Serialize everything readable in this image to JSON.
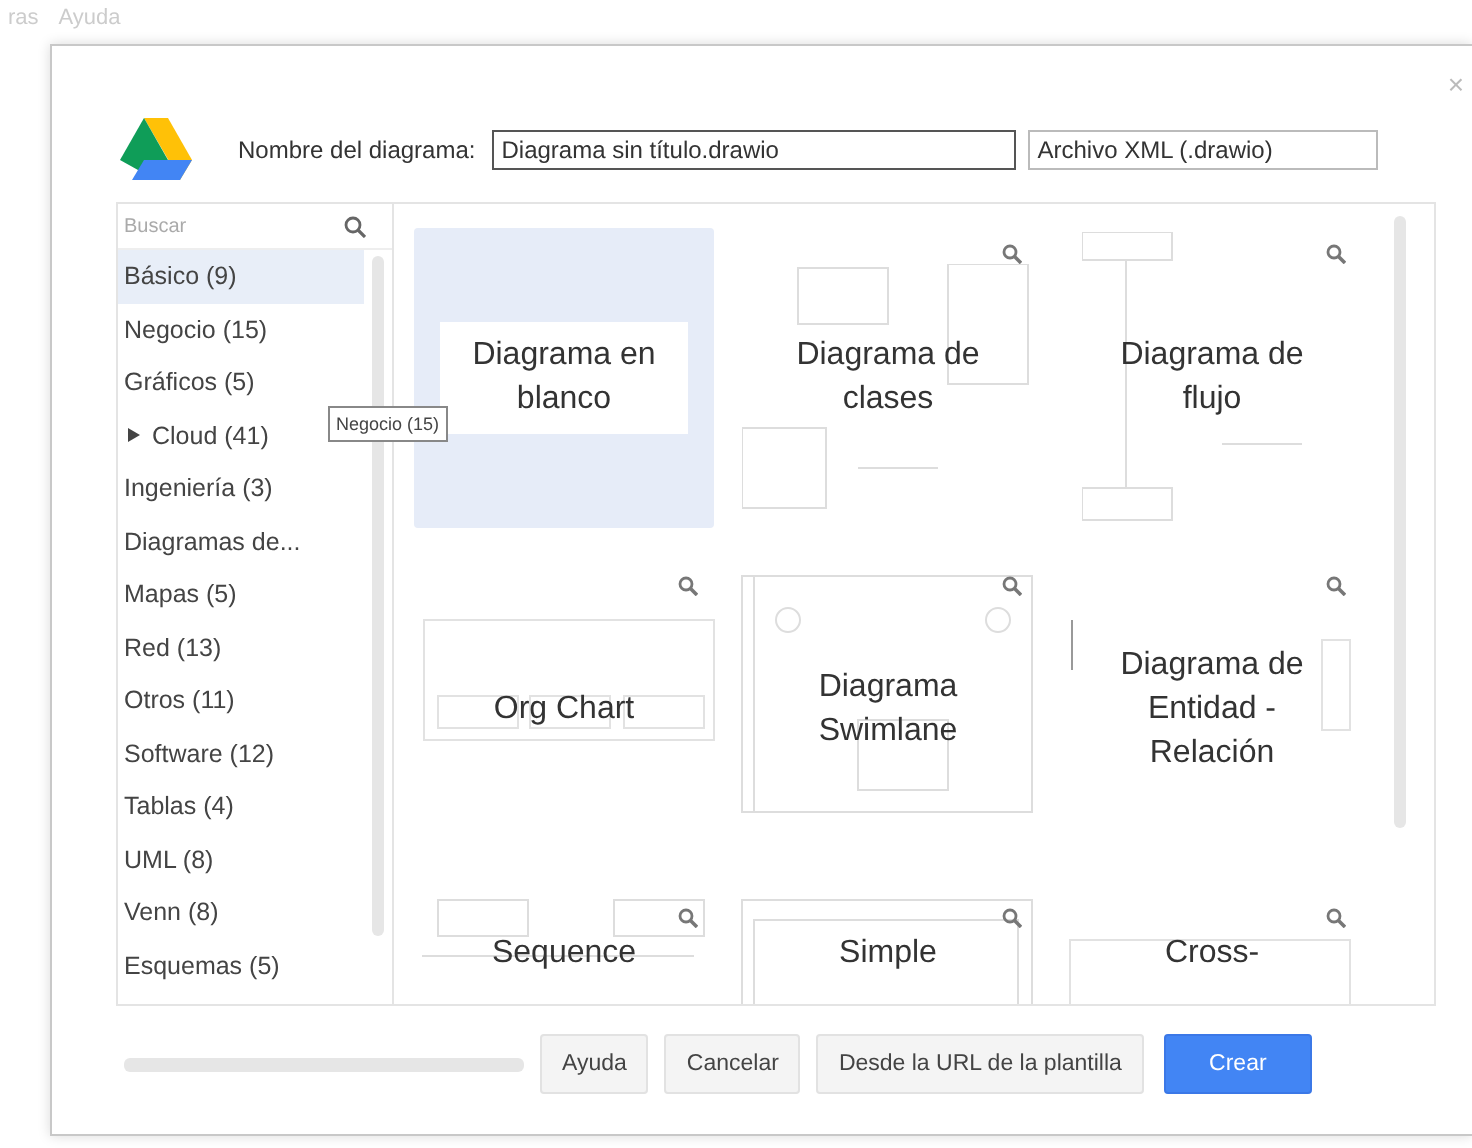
{
  "menu_bar": {
    "items": [
      "ras",
      "Ayuda"
    ]
  },
  "dialog": {
    "close": "×",
    "name_label": "Nombre del diagrama:",
    "name_value": "Diagrama sin título.drawio",
    "format": "Archivo XML (.drawio)"
  },
  "sidebar": {
    "search": {
      "placeholder": "Buscar"
    },
    "categories": [
      {
        "label": "Básico (9)",
        "kind": "item",
        "selected": true
      },
      {
        "label": "Negocio (15)",
        "kind": "item",
        "selected": false
      },
      {
        "label": "Gráficos (5)",
        "kind": "item",
        "selected": false
      },
      {
        "label": "Cloud (41)",
        "kind": "folder",
        "selected": false
      },
      {
        "label": "Ingeniería (3)",
        "kind": "item",
        "selected": false
      },
      {
        "label": "Diagramas de...",
        "kind": "item",
        "selected": false
      },
      {
        "label": "Mapas (5)",
        "kind": "item",
        "selected": false
      },
      {
        "label": "Red (13)",
        "kind": "item",
        "selected": false
      },
      {
        "label": "Otros (11)",
        "kind": "item",
        "selected": false
      },
      {
        "label": "Software (12)",
        "kind": "item",
        "selected": false
      },
      {
        "label": "Tablas (4)",
        "kind": "item",
        "selected": false
      },
      {
        "label": "UML (8)",
        "kind": "item",
        "selected": false
      },
      {
        "label": "Venn (8)",
        "kind": "item",
        "selected": false
      },
      {
        "label": "Esquemas (5)",
        "kind": "item",
        "selected": false
      }
    ]
  },
  "tooltip": "Negocio (15)",
  "templates": [
    {
      "title": "Diagrama en blanco",
      "kind": "blank",
      "selected": true
    },
    {
      "title": "Diagrama de clases",
      "kind": "classes",
      "selected": false
    },
    {
      "title": "Diagrama de flujo",
      "kind": "flow",
      "selected": false
    },
    {
      "title": "Org Chart",
      "kind": "org",
      "selected": false
    },
    {
      "title": "Diagrama Swimlane",
      "kind": "swimlane",
      "selected": false
    },
    {
      "title": "Diagrama de Entidad - Relación",
      "kind": "er",
      "selected": false
    },
    {
      "title": "Sequence",
      "kind": "sequence",
      "selected": false
    },
    {
      "title": "Simple",
      "kind": "simple",
      "selected": false
    },
    {
      "title": "Cross-",
      "kind": "cross",
      "selected": false
    }
  ],
  "buttons": [
    {
      "label": "Ayuda",
      "kind": "secondary"
    },
    {
      "label": "Cancelar",
      "kind": "secondary"
    },
    {
      "label": "Desde la URL de la plantilla",
      "kind": "secondary"
    },
    {
      "label": "Crear",
      "kind": "primary"
    }
  ]
}
